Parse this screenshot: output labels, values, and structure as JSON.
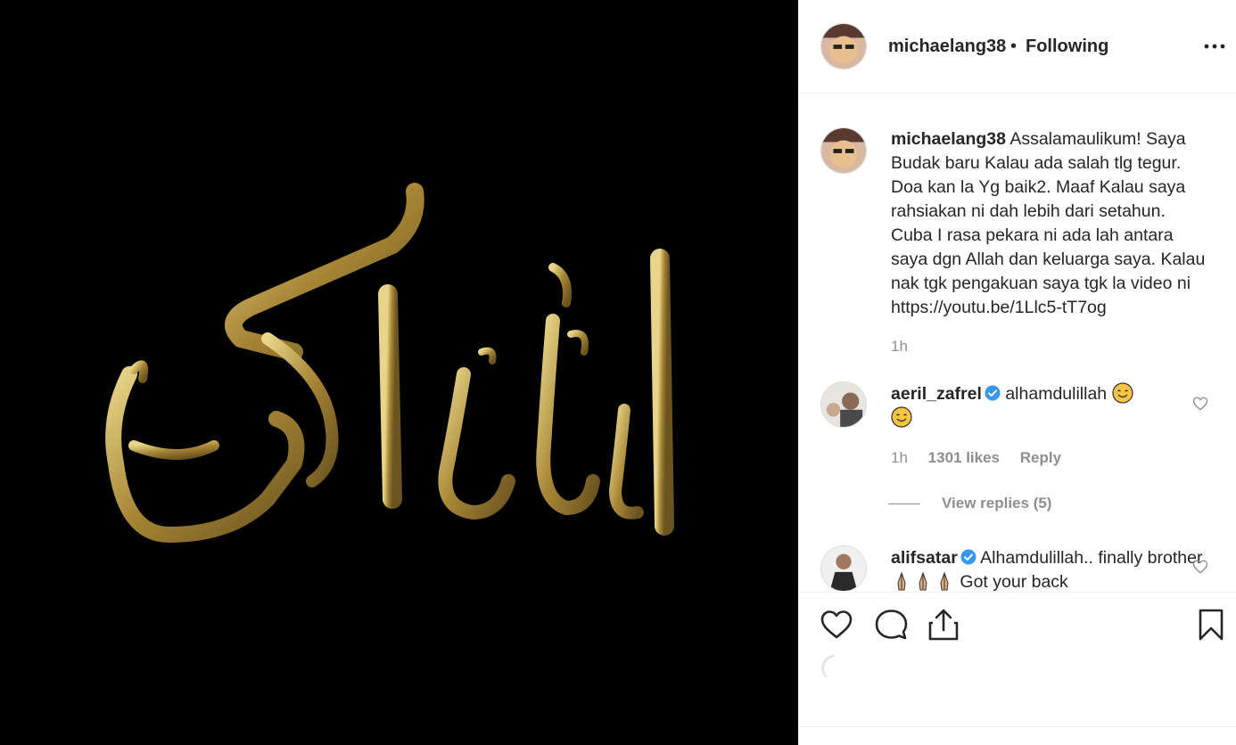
{
  "header": {
    "username": "michaelang38",
    "separator": "•",
    "follow_status": "Following",
    "more_icon": "more-options-icon"
  },
  "media": {
    "background": "#000000",
    "art_color": "#b89b4a"
  },
  "caption": {
    "username": "michaelang38",
    "text": "Assalamaulikum! Saya Budak baru Kalau ada salah tlg tegur. Doa kan la Yg baik2. Maaf Kalau saya rahsiakan ni dah lebih dari setahun. Cuba I rasa pekara ni ada lah antara saya dgn Allah dan keluarga saya. Kalau nak tgk pengakuan saya tgk la video ni https://youtu.be/1Llc5-tT7og",
    "time": "1h"
  },
  "comments": [
    {
      "username": "aeril_zafrel",
      "verified": true,
      "text": "alhamdulillah",
      "time": "1h",
      "likes": "1301 likes",
      "reply_label": "Reply",
      "view_replies": "View replies (5)"
    },
    {
      "username": "alifsatar",
      "verified": true,
      "text": "Alhamdulillah.. finally brother",
      "text_after": "Got your back"
    }
  ],
  "actions": {
    "like_icon": "heart-icon",
    "comment_icon": "comment-icon",
    "share_icon": "share-icon",
    "save_icon": "bookmark-icon"
  },
  "colors": {
    "text": "#262626",
    "muted": "#8e8e8e",
    "verified": "#3897f0",
    "border": "#efefef"
  }
}
